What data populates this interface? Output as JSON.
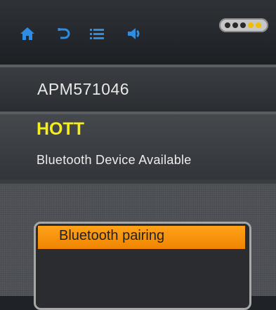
{
  "toolbar": {
    "icons": [
      "home-icon",
      "back-icon",
      "list-icon",
      "speaker-icon"
    ],
    "icon_color": "#2e8de0",
    "pager": {
      "dots": 5,
      "active": [
        3,
        4
      ],
      "active_color": "#f0c000",
      "inactive_color": "#2a2a2a"
    }
  },
  "device": {
    "id": "APM571046"
  },
  "info": {
    "name": "HOTT",
    "status": "Bluetooth Device Available"
  },
  "popup": {
    "items": [
      {
        "label": "Bluetooth pairing",
        "selected": true
      }
    ]
  }
}
